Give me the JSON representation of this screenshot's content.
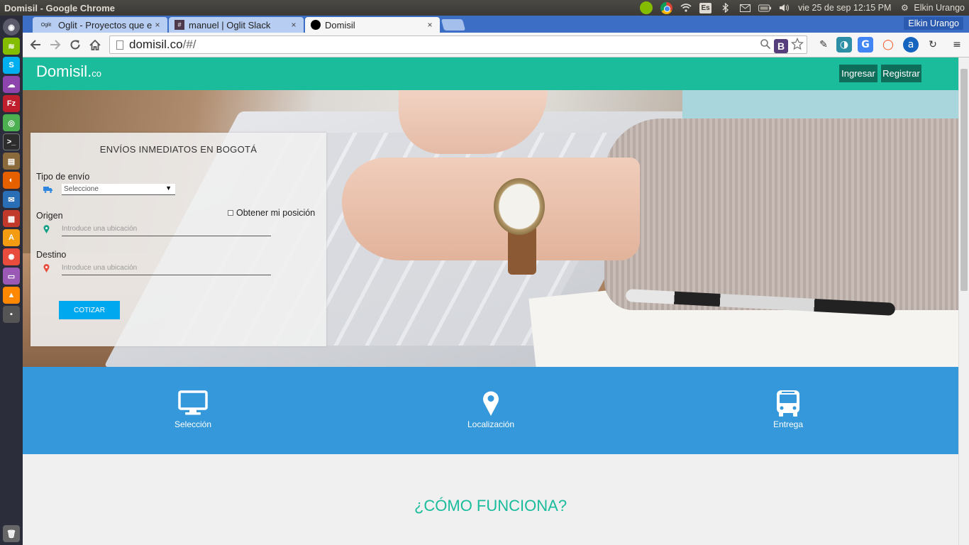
{
  "os": {
    "window_title": "Domisil - Google Chrome",
    "keyboard_layout": "Es",
    "datetime": "vie 25 de sep 12:15 PM",
    "user": "Elkin Urango"
  },
  "browser": {
    "tabs": [
      {
        "label": "Oglit - Proyectos que e",
        "favicon": "Oglit",
        "active": false
      },
      {
        "label": "manuel | Oglit Slack",
        "favicon": "#",
        "active": false
      },
      {
        "label": "Domisil",
        "favicon": "",
        "active": true
      }
    ],
    "close_glyph": "×",
    "profile": "Elkin Urango",
    "url_host": "domisil.co",
    "url_path": "/#/"
  },
  "site": {
    "logo": "Domisil",
    "logo_dot": ".",
    "logo_tld": "co",
    "nav": {
      "login": "Ingresar",
      "register": "Registrar"
    },
    "form": {
      "title": "ENVÍOS INMEDIATOS EN BOGOTÁ",
      "type_label": "Tipo de envío",
      "type_selected": "Seleccione",
      "origin_label": "Origen",
      "origin_placeholder": "Introduce una ubicación",
      "geo_label": "Obtener mi posición",
      "destination_label": "Destino",
      "destination_placeholder": "Introduce una ubicación",
      "submit": "COTIZAR"
    },
    "features": [
      {
        "label": "Selección",
        "icon": "monitor-icon"
      },
      {
        "label": "Localización",
        "icon": "map-pin-icon"
      },
      {
        "label": "Entrega",
        "icon": "bus-icon"
      }
    ],
    "how_title": "¿CÓMO FUNCIONA?"
  },
  "colors": {
    "brand": "#1abc9c",
    "nav_button": "#0f6e59",
    "features_band": "#3498db",
    "submit_button": "#00a8f0"
  }
}
